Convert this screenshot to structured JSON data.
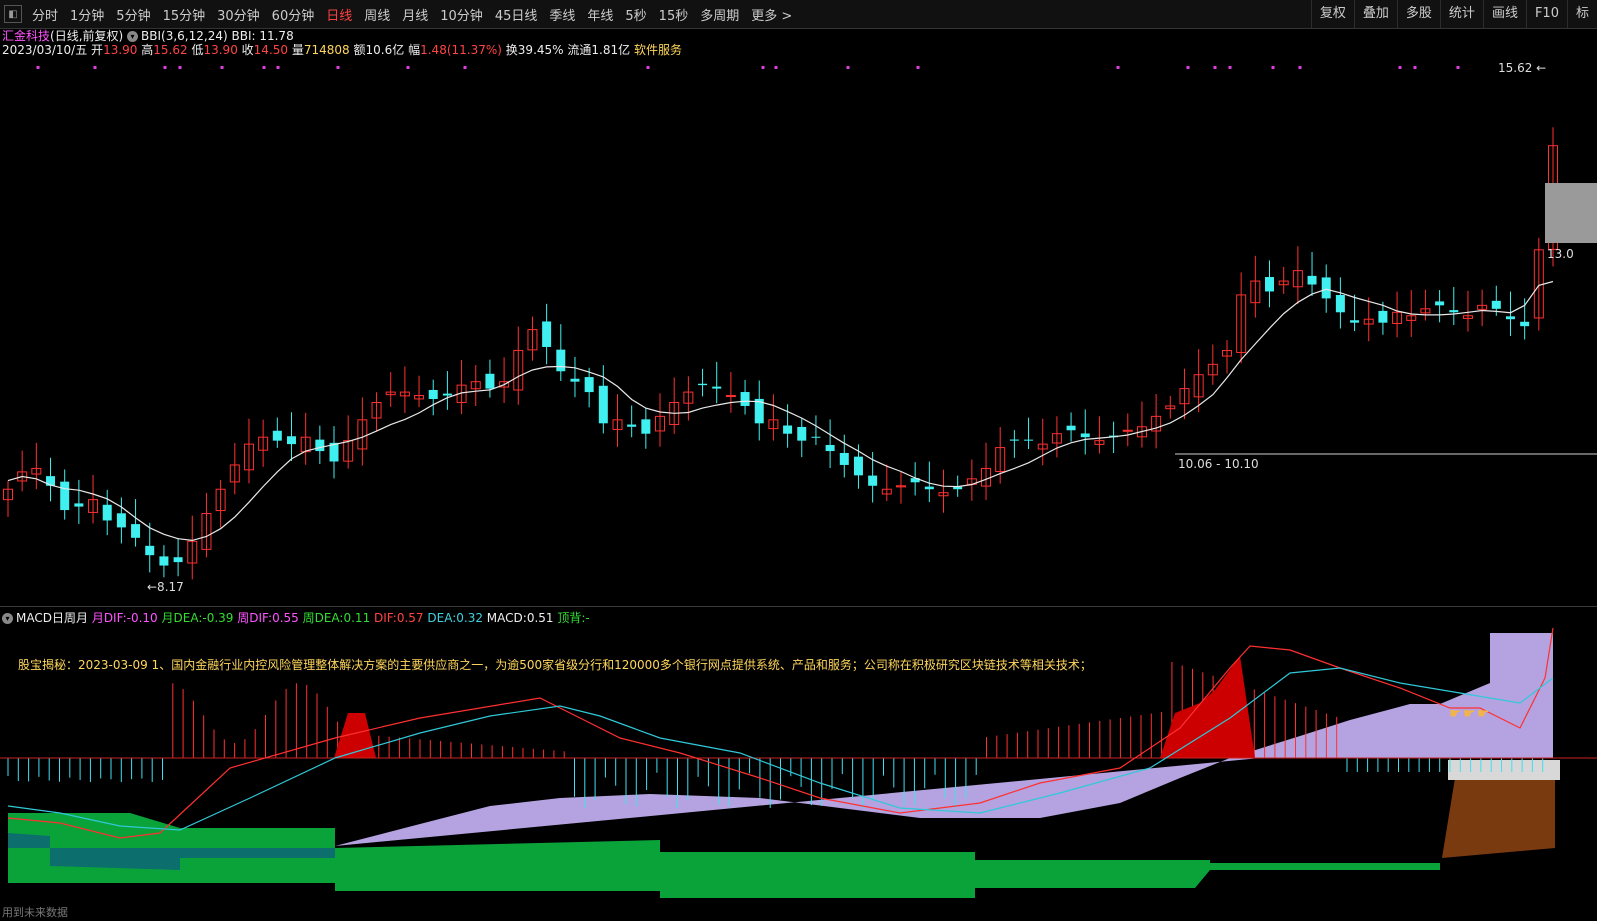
{
  "toolbar": {
    "periods": [
      "分时",
      "1分钟",
      "5分钟",
      "15分钟",
      "30分钟",
      "60分钟",
      "日线",
      "周线",
      "月线",
      "10分钟",
      "45日线",
      "季线",
      "年线",
      "5秒",
      "15秒",
      "多周期",
      "更多 >"
    ],
    "active_index": 6,
    "right_buttons": [
      "复权",
      "叠加",
      "多股",
      "统计",
      "画线",
      "F10",
      "标"
    ]
  },
  "stock": {
    "name": "汇金科技",
    "mode": "(日线,前复权)",
    "indicator": "BBI(3,6,12,24)",
    "bbi_label": "BBI: 11.78",
    "date": "2023/03/10/五",
    "open_label": "开",
    "open": "13.90",
    "high_label": "高",
    "high": "15.62",
    "low_label": "低",
    "low": "13.90",
    "close_label": "收",
    "close": "14.50",
    "vol_label": "量",
    "vol": "714808",
    "amt_label": "额",
    "amt": "10.6亿",
    "chg_label": "幅",
    "chg": "1.48(11.37%)",
    "turn_label": "换",
    "turn": "39.45%",
    "float_label": "流通",
    "float": "1.81亿",
    "sector": "软件服务"
  },
  "price_chart": {
    "max_label": "15.62",
    "min_label": "8.17",
    "range_label": "10.06 - 10.10",
    "right_price": "13.0",
    "colors": {
      "up": "#ff3030",
      "down": "#40f0f0",
      "bbi": "#e8e8e8"
    }
  },
  "macd": {
    "title": "MACD日周月",
    "m_dif_label": "月DIF:",
    "m_dif": "-0.10",
    "m_dea_label": "月DEA:",
    "m_dea": "-0.39",
    "w_dif_label": "周DIF:",
    "w_dif": "0.55",
    "w_dea_label": "周DEA:",
    "w_dea": "0.11",
    "dif_label": "DIF:",
    "dif": "0.57",
    "dea_label": "DEA:",
    "dea": "0.32",
    "macd_label": "MACD:",
    "macd_val": "0.51",
    "top_label": "顶背:",
    "top_val": "-"
  },
  "notice": "股宝揭秘：2023-03-09 1、国内金融行业内控风险管理整体解决方案的主要供应商之一，为逾500家省级分行和120000多个银行网点提供系统、产品和服务；公司称在积极研究区块链技术等相关技术；",
  "footer": "用到未来数据"
}
